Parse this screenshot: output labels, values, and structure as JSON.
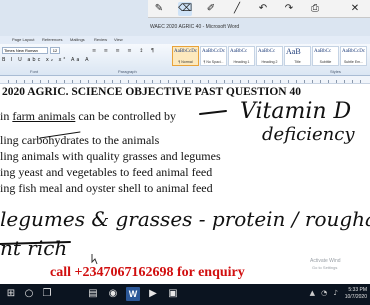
{
  "window": {
    "title": "WAEC 2020 AGRIC 40 - Microsoft Word"
  },
  "ink_toolbar": {
    "tools": [
      {
        "name": "pen-tool",
        "glyph": "✎"
      },
      {
        "name": "eraser-tool",
        "glyph": "⌫"
      },
      {
        "name": "highlighter-tool",
        "glyph": "✐"
      },
      {
        "name": "line-tool",
        "glyph": "╱"
      },
      {
        "name": "undo-tool",
        "glyph": "↶"
      },
      {
        "name": "redo-tool",
        "glyph": "↷"
      },
      {
        "name": "screenshot-tool",
        "glyph": "⎙"
      },
      {
        "name": "close-tool",
        "glyph": "✕"
      }
    ]
  },
  "ribbon": {
    "tabs": [
      "Page Layout",
      "References",
      "Mailings",
      "Review",
      "View"
    ],
    "font_name": "Times New Roman",
    "font_size": "12",
    "format_buttons": "B I U abc x₂ x² Aa A",
    "paragraph_buttons": "≡ ≡ ≡ ≡ ↕ ¶",
    "group_labels": {
      "font": "Font",
      "paragraph": "Paragraph",
      "styles": "Styles"
    },
    "styles": [
      {
        "sample": "AaBbCcDc",
        "name": "¶ Normal",
        "selected": true
      },
      {
        "sample": "AaBbCcDc",
        "name": "¶ No Spaci...",
        "selected": false
      },
      {
        "sample": "AaBbCc",
        "name": "Heading 1",
        "selected": false
      },
      {
        "sample": "AaBbCc",
        "name": "Heading 2",
        "selected": false
      },
      {
        "sample": "AaB",
        "name": "Title",
        "selected": false
      },
      {
        "sample": "AaBbCc",
        "name": "Subtitle",
        "selected": false
      },
      {
        "sample": "AaBbCcDc",
        "name": "Subtle Em...",
        "selected": false
      }
    ]
  },
  "document": {
    "title": "2020 AGRIC. SCIENCE OBJECTIVE PAST QUESTION 40",
    "question_prefix": "in ",
    "question_underlined": "farm animals",
    "question_suffix": " can be controlled by",
    "options": [
      "ling carbohydrates to the animals",
      "ling animals with quality grasses and legumes",
      "ing yeast and vegetables to feed animal feed",
      "ing fish meal and oyster shell to animal feed"
    ],
    "handwritten_notes": [
      "Vitamin D",
      "deficiency",
      "legumes & grasses - protein / roughage",
      "nt rich"
    ]
  },
  "overlay": {
    "enquiry": "call +2347067162698 for enquiry",
    "watermark_line1": "Activate Wind",
    "watermark_line2": "Go to Settings"
  },
  "taskbar": {
    "time": "5:33 PM",
    "date": "10/7/2020",
    "icons": [
      "start-icon",
      "search-icon",
      "task-view-icon",
      "file-explorer-icon",
      "browser-icon",
      "word-icon",
      "media-icon",
      "store-icon"
    ]
  },
  "colors": {
    "enquiry": "#d10e0e",
    "ink": "#111111",
    "ribbon": "#dbe6f3",
    "taskbar": "#0b1420"
  }
}
